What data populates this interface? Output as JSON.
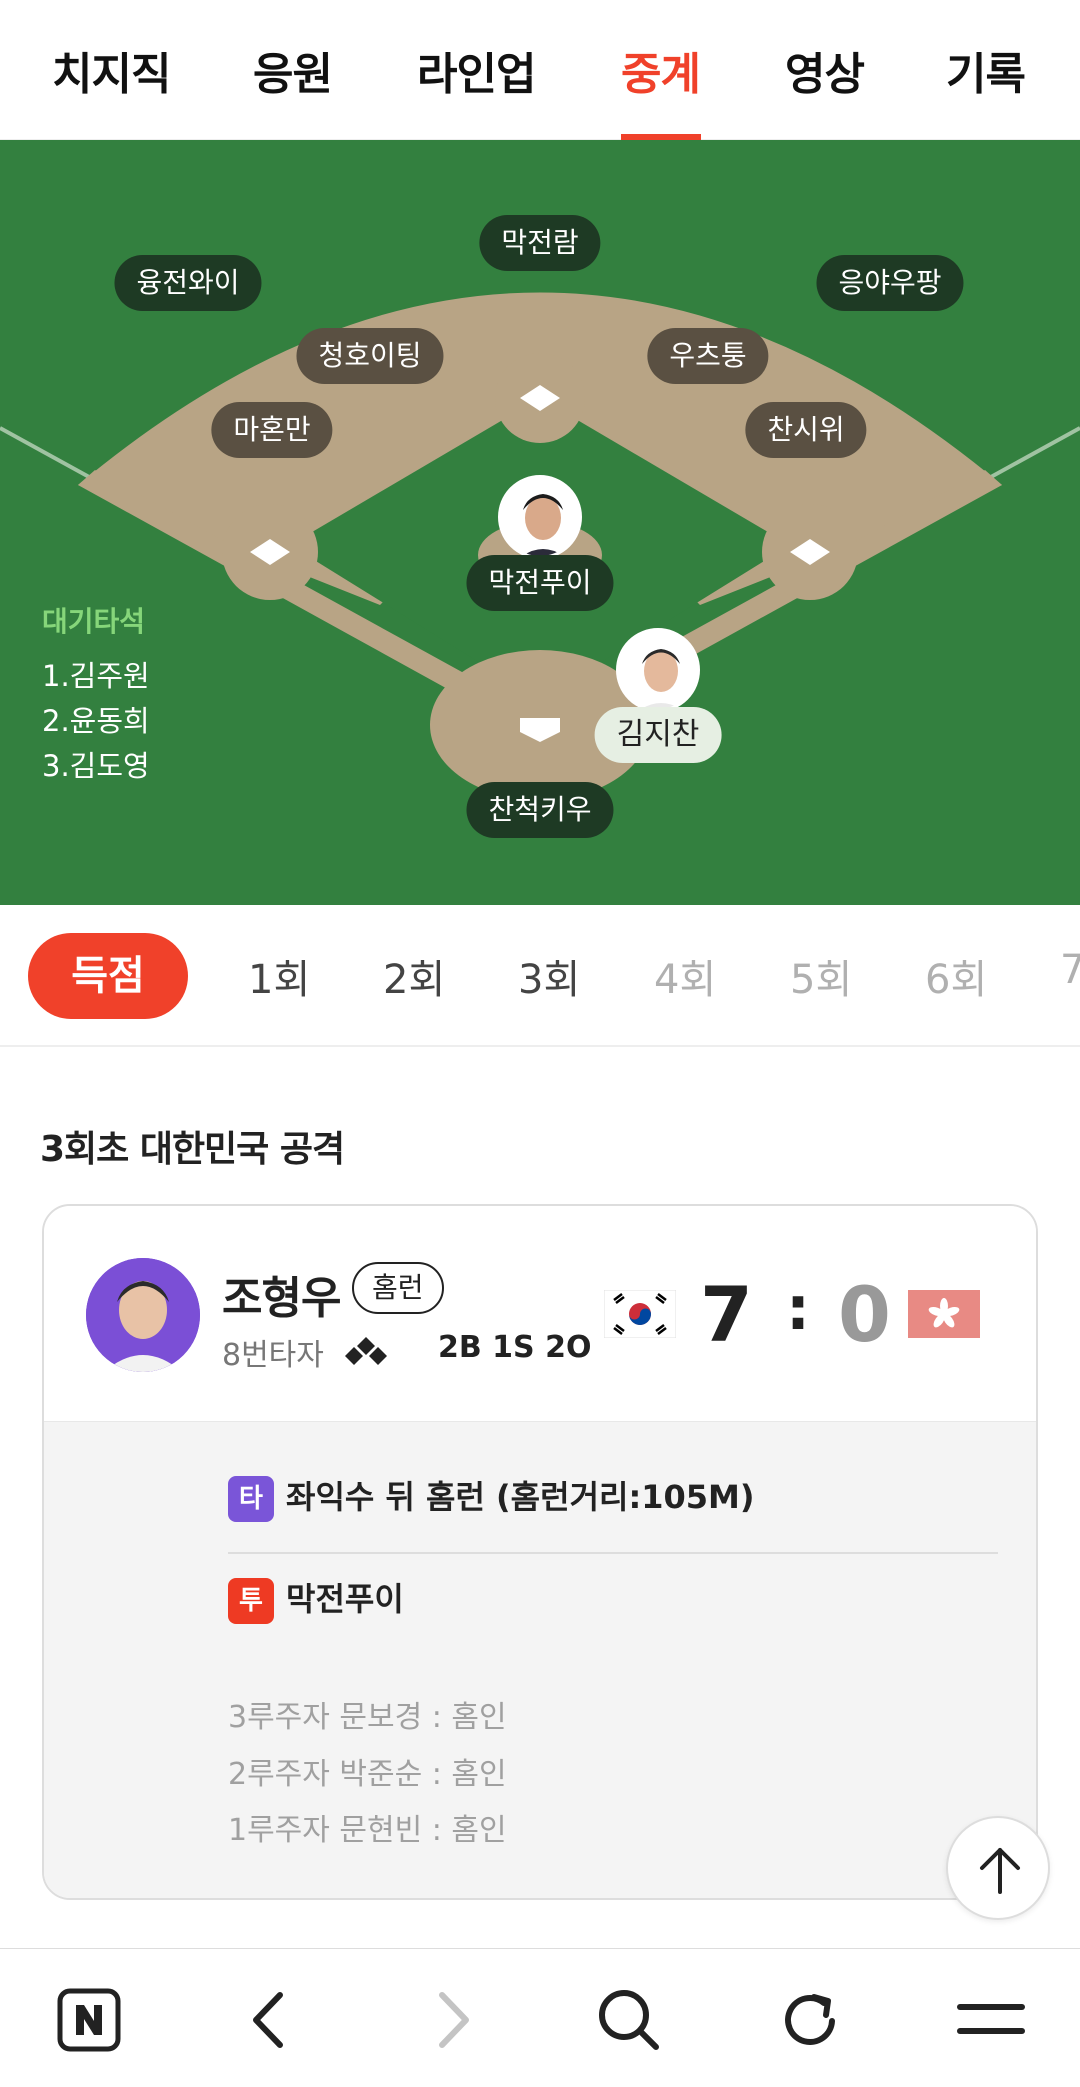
{
  "top_tabs": [
    {
      "label": "치지직"
    },
    {
      "label": "응원"
    },
    {
      "label": "라인업"
    },
    {
      "label": "중계"
    },
    {
      "label": "영상"
    },
    {
      "label": "기록"
    }
  ],
  "field": {
    "fielders": {
      "center": "막전람",
      "left": "융전와이",
      "right": "응야우팡",
      "shortstop": "청호이팅",
      "second": "우츠퉁",
      "third": "마혼만",
      "first": "찬시위",
      "pitcher": "막전푸이",
      "catcher": "찬척키우"
    },
    "batter": "김지찬",
    "on_deck_title": "대기타석",
    "on_deck": [
      "1.김주원",
      "2.윤동희",
      "3.김도영"
    ]
  },
  "innings": {
    "score_label": "득점",
    "items": [
      "1회",
      "2회",
      "3회",
      "4회",
      "5회",
      "6회",
      "7"
    ]
  },
  "section": {
    "title": "3회초 대한민국 공격"
  },
  "card": {
    "player_name": "조형우",
    "badge": "홈런",
    "order": "8번타자",
    "count": "2B 1S 2O",
    "score_home": "7",
    "score_sep": ":",
    "score_away": "0",
    "bat_tag": "타",
    "bat_event": "좌익수 뒤 홈런 (홈런거리:105M)",
    "pitch_tag": "투",
    "pitcher": "막전푸이",
    "runners": [
      "3루주자 문보경 : 홈인",
      "2루주자 박준순 : 홈인",
      "1루주자 문현빈 : 홈인"
    ]
  },
  "colors": {
    "accent": "#f0412a",
    "field_grass": "#33803f",
    "infield_dirt": "#b8a485",
    "bat_tag": "#7a55d8",
    "pitch_tag": "#ee3a23"
  },
  "icons": {
    "bottom_bar": [
      "naver-n-icon",
      "back-icon",
      "forward-icon",
      "search-icon",
      "refresh-icon",
      "menu-icon"
    ],
    "scroll_top": "arrow-up-icon"
  }
}
